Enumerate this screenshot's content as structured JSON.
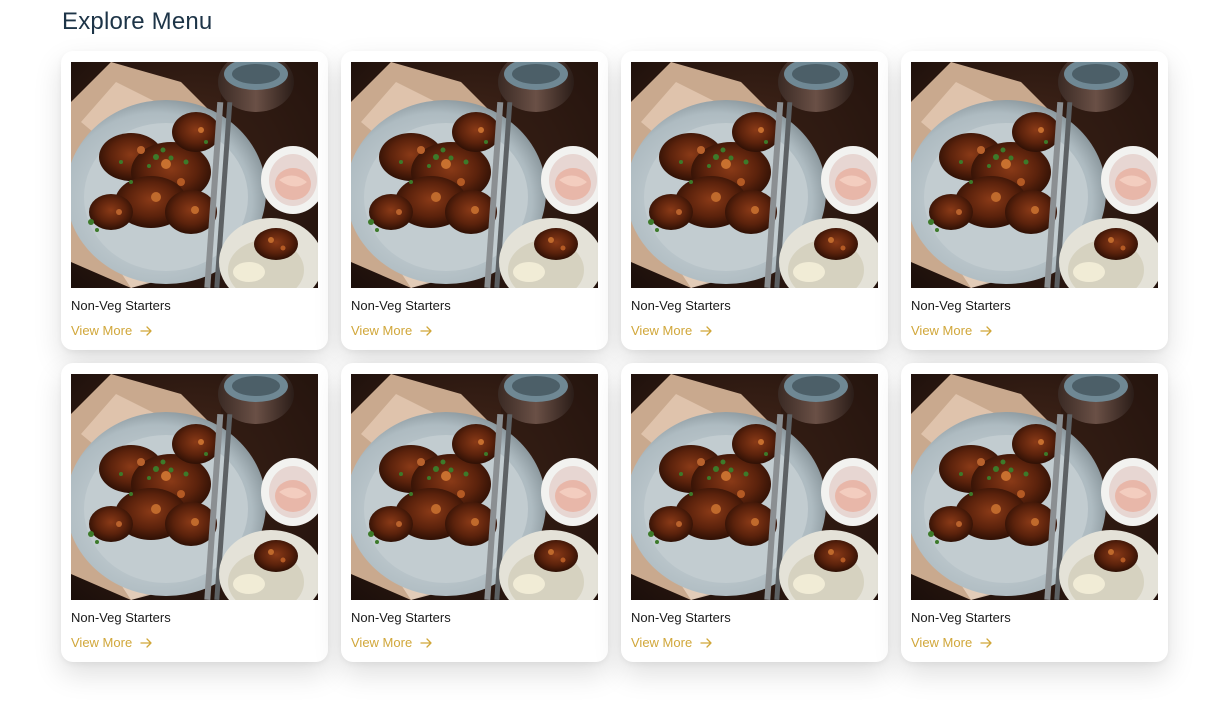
{
  "section": {
    "title": "Explore Menu"
  },
  "colors": {
    "accent": "#d1a73a",
    "title": "#1d3447"
  },
  "cards": [
    {
      "title": "Non-Veg Starters",
      "link": "View More",
      "image_icon": "food-plate-image",
      "link_icon": "arrow-right-icon"
    },
    {
      "title": "Non-Veg Starters",
      "link": "View More",
      "image_icon": "food-plate-image",
      "link_icon": "arrow-right-icon"
    },
    {
      "title": "Non-Veg Starters",
      "link": "View More",
      "image_icon": "food-plate-image",
      "link_icon": "arrow-right-icon"
    },
    {
      "title": "Non-Veg Starters",
      "link": "View More",
      "image_icon": "food-plate-image",
      "link_icon": "arrow-right-icon"
    },
    {
      "title": "Non-Veg Starters",
      "link": "View More",
      "image_icon": "food-plate-image",
      "link_icon": "arrow-right-icon"
    },
    {
      "title": "Non-Veg Starters",
      "link": "View More",
      "image_icon": "food-plate-image",
      "link_icon": "arrow-right-icon"
    },
    {
      "title": "Non-Veg Starters",
      "link": "View More",
      "image_icon": "food-plate-image",
      "link_icon": "arrow-right-icon"
    },
    {
      "title": "Non-Veg Starters",
      "link": "View More",
      "image_icon": "food-plate-image",
      "link_icon": "arrow-right-icon"
    }
  ]
}
